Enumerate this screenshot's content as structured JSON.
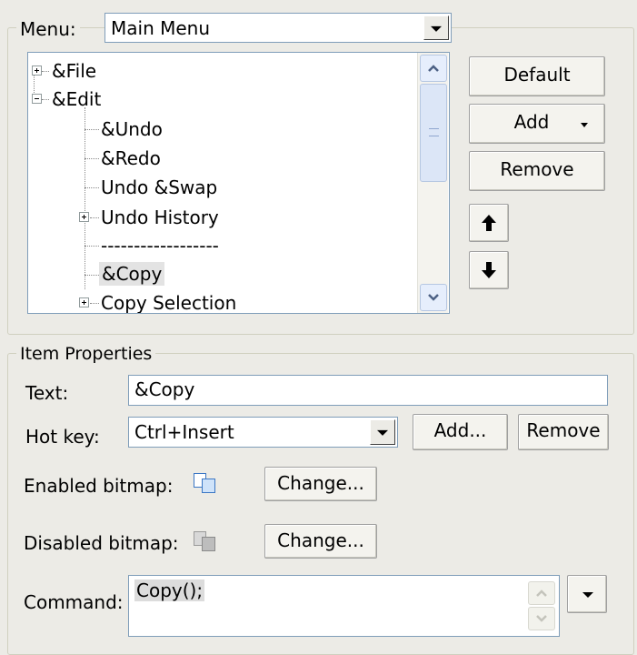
{
  "menu_group": {
    "label": "Menu:",
    "menu_combo_value": "Main Menu"
  },
  "tree": {
    "items": [
      {
        "label": "&File",
        "expander": "plus"
      },
      {
        "label": "&Edit",
        "expander": "minus"
      },
      {
        "label": "&Undo"
      },
      {
        "label": "&Redo"
      },
      {
        "label": "Undo &Swap"
      },
      {
        "label": "Undo History",
        "expander": "plus"
      },
      {
        "label": "------------------"
      },
      {
        "label": "&Copy",
        "selected": true
      },
      {
        "label": "Copy Selection",
        "expander": "plus"
      }
    ]
  },
  "buttons": {
    "default": "Default",
    "add": "Add",
    "remove": "Remove",
    "move_up_icon": "arrow-up-icon",
    "move_down_icon": "arrow-down-icon"
  },
  "item_properties": {
    "label": "Item Properties",
    "text_label": "Text:",
    "text_value": "&Copy",
    "hotkey_label": "Hot key:",
    "hotkey_value": "Ctrl+Insert",
    "hotkey_add": "Add...",
    "hotkey_remove": "Remove",
    "enabled_bitmap_label": "Enabled bitmap:",
    "enabled_bitmap_change": "Change...",
    "disabled_bitmap_label": "Disabled bitmap:",
    "disabled_bitmap_change": "Change...",
    "command_label": "Command:",
    "command_value": "Copy();"
  },
  "colors": {
    "background": "#ecebe6",
    "selection": "#e3e3e3",
    "border": "#7f9db9"
  }
}
